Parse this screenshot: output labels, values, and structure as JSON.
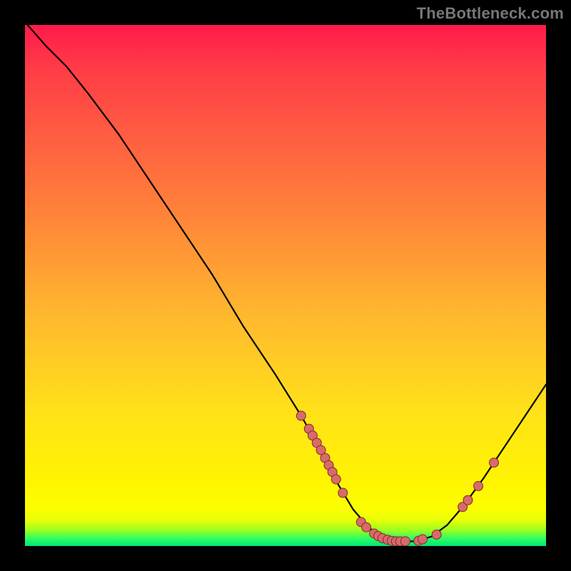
{
  "watermark": "TheBottleneck.com",
  "colors": {
    "curve": "#000000",
    "dot_fill": "#d96a6a",
    "dot_border": "#7a2f2f"
  },
  "chart_data": {
    "type": "line",
    "title": "",
    "xlabel": "",
    "ylabel": "",
    "xlim": [
      0,
      100
    ],
    "ylim": [
      0,
      100
    ],
    "curve": [
      {
        "x": 0.5,
        "y": 100
      },
      {
        "x": 4,
        "y": 96
      },
      {
        "x": 8,
        "y": 92
      },
      {
        "x": 12,
        "y": 87
      },
      {
        "x": 18,
        "y": 79
      },
      {
        "x": 24,
        "y": 70
      },
      {
        "x": 30,
        "y": 61
      },
      {
        "x": 36,
        "y": 52
      },
      {
        "x": 42,
        "y": 42
      },
      {
        "x": 48,
        "y": 33
      },
      {
        "x": 53,
        "y": 25
      },
      {
        "x": 57,
        "y": 18
      },
      {
        "x": 60,
        "y": 12
      },
      {
        "x": 63,
        "y": 7
      },
      {
        "x": 66,
        "y": 3.5
      },
      {
        "x": 69,
        "y": 1.6
      },
      {
        "x": 72,
        "y": 0.9
      },
      {
        "x": 75,
        "y": 0.9
      },
      {
        "x": 78,
        "y": 1.8
      },
      {
        "x": 81,
        "y": 4
      },
      {
        "x": 84,
        "y": 7.5
      },
      {
        "x": 88,
        "y": 13
      },
      {
        "x": 92,
        "y": 19
      },
      {
        "x": 96,
        "y": 25
      },
      {
        "x": 100,
        "y": 31
      }
    ],
    "points": [
      {
        "x": 53,
        "y": 25
      },
      {
        "x": 54.5,
        "y": 22.5
      },
      {
        "x": 55.2,
        "y": 21.2
      },
      {
        "x": 56,
        "y": 19.8
      },
      {
        "x": 56.8,
        "y": 18.4
      },
      {
        "x": 57.6,
        "y": 16.9
      },
      {
        "x": 58.3,
        "y": 15.5
      },
      {
        "x": 59,
        "y": 14.2
      },
      {
        "x": 59.7,
        "y": 12.8
      },
      {
        "x": 61,
        "y": 10.2
      },
      {
        "x": 64.5,
        "y": 4.6
      },
      {
        "x": 65.5,
        "y": 3.6
      },
      {
        "x": 67,
        "y": 2.4
      },
      {
        "x": 67.8,
        "y": 1.9
      },
      {
        "x": 68.6,
        "y": 1.5
      },
      {
        "x": 69.6,
        "y": 1.2
      },
      {
        "x": 70.4,
        "y": 1.0
      },
      {
        "x": 71.2,
        "y": 0.9
      },
      {
        "x": 72,
        "y": 0.9
      },
      {
        "x": 73,
        "y": 0.9
      },
      {
        "x": 75.5,
        "y": 1.0
      },
      {
        "x": 76.3,
        "y": 1.3
      },
      {
        "x": 79,
        "y": 2.2
      },
      {
        "x": 84,
        "y": 7.5
      },
      {
        "x": 85,
        "y": 8.8
      },
      {
        "x": 87,
        "y": 11.5
      },
      {
        "x": 90,
        "y": 16
      }
    ],
    "dot_radius": 6.5
  }
}
